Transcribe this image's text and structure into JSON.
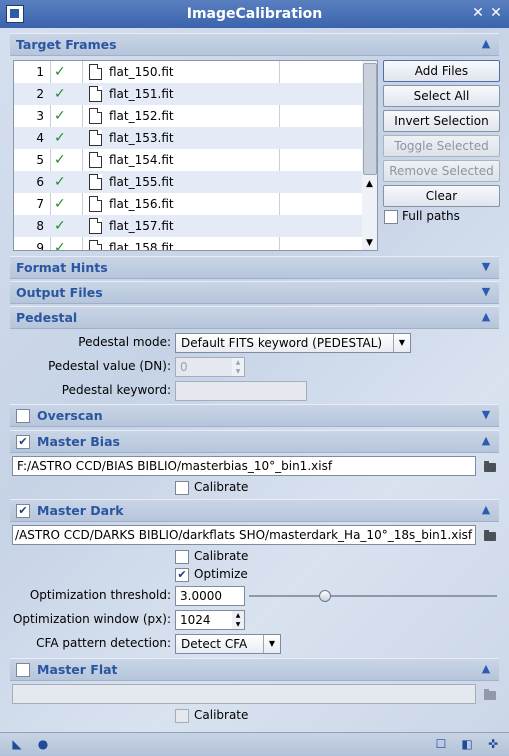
{
  "window": {
    "title": "ImageCalibration",
    "buttons": [
      "✕",
      "✕"
    ]
  },
  "target_frames": {
    "header": "Target Frames",
    "files": [
      {
        "num": "1",
        "name": "flat_150.fit"
      },
      {
        "num": "2",
        "name": "flat_151.fit"
      },
      {
        "num": "3",
        "name": "flat_152.fit"
      },
      {
        "num": "4",
        "name": "flat_153.fit"
      },
      {
        "num": "5",
        "name": "flat_154.fit"
      },
      {
        "num": "6",
        "name": "flat_155.fit"
      },
      {
        "num": "7",
        "name": "flat_156.fit"
      },
      {
        "num": "8",
        "name": "flat_157.fit"
      },
      {
        "num": "9",
        "name": "flat_158.fit"
      }
    ],
    "add_files": "Add Files",
    "select_all": "Select All",
    "invert_selection": "Invert Selection",
    "toggle_selected": "Toggle Selected",
    "remove_selected": "Remove Selected",
    "clear": "Clear",
    "full_paths": "Full paths"
  },
  "format_hints": {
    "header": "Format Hints"
  },
  "output_files": {
    "header": "Output Files"
  },
  "pedestal": {
    "header": "Pedestal",
    "mode_label": "Pedestal mode:",
    "mode_value": "Default FITS keyword (PEDESTAL)",
    "value_label": "Pedestal value (DN):",
    "value": "0",
    "keyword_label": "Pedestal keyword:",
    "keyword_value": ""
  },
  "overscan": {
    "header": "Overscan",
    "checked": false
  },
  "master_bias": {
    "header": "Master Bias",
    "checked": true,
    "path": "F:/ASTRO CCD/BIAS BIBLIO/masterbias_10°_bin1.xisf",
    "calibrate_label": "Calibrate",
    "calibrate_checked": false
  },
  "master_dark": {
    "header": "Master Dark",
    "checked": true,
    "path": "/ASTRO CCD/DARKS BIBLIO/darkflats SHO/masterdark_Ha_10°_18s_bin1.xisf",
    "calibrate_label": "Calibrate",
    "calibrate_checked": false,
    "optimize_label": "Optimize",
    "optimize_checked": true,
    "threshold_label": "Optimization threshold:",
    "threshold_value": "3.0000",
    "window_label": "Optimization window (px):",
    "window_value": "1024",
    "cfa_label": "CFA pattern detection:",
    "cfa_value": "Detect CFA"
  },
  "master_flat": {
    "header": "Master Flat",
    "checked": false,
    "path": "",
    "calibrate_label": "Calibrate",
    "calibrate_checked": false
  },
  "colors": {
    "header_text": "#2a55a0",
    "check_ok": "#1d8f2a",
    "title_bar": "#3a64ad"
  }
}
